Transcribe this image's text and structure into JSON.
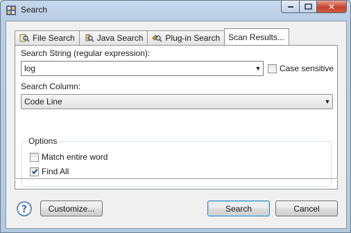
{
  "window": {
    "title": "Search",
    "close_glyph": "✕"
  },
  "tabs": [
    {
      "label": "File Search",
      "icon": "file-search-icon"
    },
    {
      "label": "Java Search",
      "icon": "java-search-icon"
    },
    {
      "label": "Plug-in Search",
      "icon": "plugin-search-icon"
    },
    {
      "label": "Scan Results...",
      "icon": ""
    }
  ],
  "active_tab": "Scan Results...",
  "form": {
    "search_string_label": "Search String (regular expression):",
    "search_string_value": "log",
    "case_sensitive_label": "Case sensitive",
    "case_sensitive_checked": false,
    "search_column_label": "Search Column:",
    "search_column_value": "Code Line",
    "options_label": "Options",
    "match_entire_word_label": "Match entire word",
    "match_entire_word_checked": false,
    "find_all_label": "Find All",
    "find_all_checked": true
  },
  "buttons": {
    "customize": "Customize...",
    "search": "Search",
    "cancel": "Cancel"
  },
  "colors": {
    "accent": "#3c7fb1",
    "help": "#3a6fb0"
  }
}
